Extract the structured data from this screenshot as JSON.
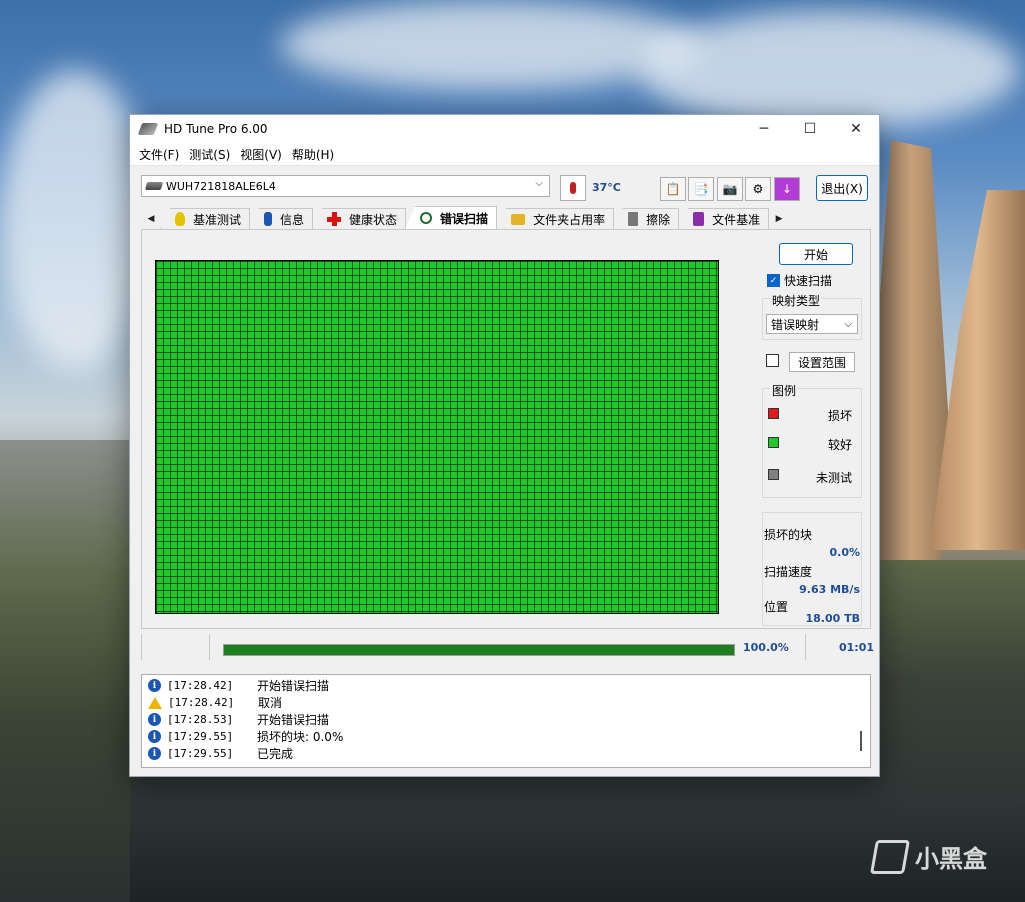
{
  "window": {
    "title": "HD Tune Pro 6.00",
    "controls": {
      "minimize": "─",
      "maximize": "☐",
      "close": "✕"
    }
  },
  "menu": [
    "文件(F)",
    "测试(S)",
    "视图(V)",
    "帮助(H)"
  ],
  "toolbar": {
    "drive": "WUH721818ALE6L4",
    "temperature": "37°C",
    "exit_label": "退出(X)",
    "icons": [
      "copy-text-icon",
      "copy-image-icon",
      "camera-icon",
      "settings-icon",
      "save-icon"
    ]
  },
  "tabs": {
    "scroll_left": "◀",
    "scroll_right": "▶",
    "items": [
      {
        "label": "基准测试",
        "icon": "lightbulb-icon"
      },
      {
        "label": "信息",
        "icon": "info-icon"
      },
      {
        "label": "健康状态",
        "icon": "health-cross-icon"
      },
      {
        "label": "错误扫描",
        "icon": "magnifier-icon",
        "active": true
      },
      {
        "label": "文件夹占用率",
        "icon": "folder-icon"
      },
      {
        "label": "擦除",
        "icon": "trash-icon"
      },
      {
        "label": "文件基准",
        "icon": "file-benchmark-icon"
      }
    ]
  },
  "scan": {
    "start_label": "开始",
    "quick_scan_label": "快速扫描",
    "quick_scan_checked": true,
    "map_type_label": "映射类型",
    "map_type_value": "错误映射",
    "set_range_label": "设置范围",
    "set_range_checked": false,
    "legend_title": "图例",
    "legend": [
      {
        "label": "损坏",
        "color": "#e01b1b"
      },
      {
        "label": "较好",
        "color": "#22c82a"
      },
      {
        "label": "未测试",
        "color": "#808080"
      }
    ],
    "damaged_blocks_label": "损坏的块",
    "damaged_blocks_value": "0.0%",
    "scan_speed_label": "扫描速度",
    "scan_speed_value": "9.63 MB/s",
    "position_label": "位置",
    "position_value": "18.00 TB",
    "grid_color": "#22c82a"
  },
  "status": {
    "progress_percent": 100,
    "progress_text": "100.0%",
    "elapsed": "01:01"
  },
  "log": [
    {
      "type": "info",
      "time": "[17:28.42]",
      "message": "开始错误扫描"
    },
    {
      "type": "warning",
      "time": "[17:28.42]",
      "message": "取消"
    },
    {
      "type": "info",
      "time": "[17:28.53]",
      "message": "开始错误扫描"
    },
    {
      "type": "info",
      "time": "[17:29.55]",
      "message": "损坏的块: 0.0%"
    },
    {
      "type": "info",
      "time": "[17:29.55]",
      "message": "已完成"
    }
  ],
  "watermark": "小黑盒"
}
